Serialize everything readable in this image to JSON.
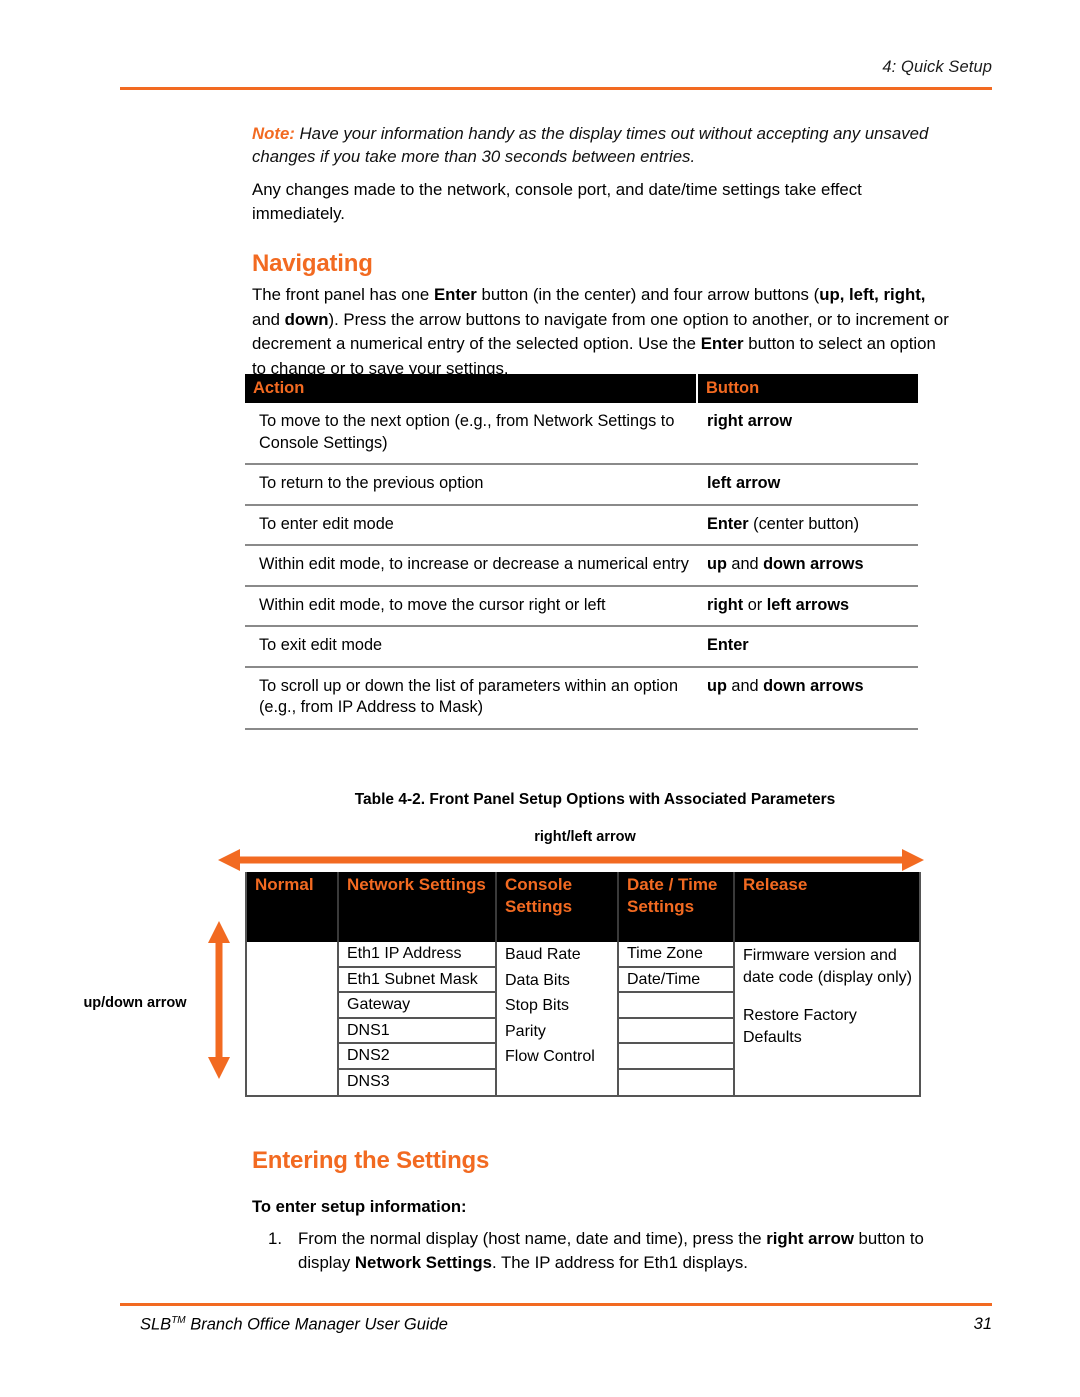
{
  "header": {
    "chapter": "4: Quick Setup",
    "rule_color": "#F26A21"
  },
  "note": {
    "label": "Note:",
    "text": " Have your information handy as the display times out without accepting any unsaved changes if you take more than 30 seconds between entries."
  },
  "paragraphs": {
    "immediate_effect": "Any changes made to the network, console port, and date/time settings take effect immediately."
  },
  "sections": {
    "navigating": "Navigating",
    "entering": "Entering the Settings"
  },
  "navigating_paragraph": {
    "p1": "The front panel has one ",
    "b1": "Enter",
    "p2": " button (in the center) and four arrow buttons (",
    "b2": "up, left, right,",
    "p3": " and ",
    "b3": "down",
    "p4": "). Press the arrow buttons to navigate from one option to another, or to increment or decrement a numerical entry of the selected option. Use the ",
    "b4": "Enter",
    "p5": " button to select an option to change or to save your settings."
  },
  "action_table": {
    "headers": [
      "Action",
      "Button"
    ],
    "rows": [
      {
        "action": "To move to the next option (e.g., from Network Settings to Console Settings)",
        "button_bold": "right arrow",
        "button_rest": ""
      },
      {
        "action": "To return to the previous option",
        "button_bold": "left arrow",
        "button_rest": ""
      },
      {
        "action": "To enter edit mode",
        "button_bold": "Enter",
        "button_rest": " (center button)"
      },
      {
        "action": "Within edit mode, to increase or decrease a numerical entry",
        "button_bold": "up",
        "button_mid": " and ",
        "button_bold2": "down arrows",
        "button_rest": ""
      },
      {
        "action": "Within edit mode, to move the cursor right or left",
        "button_bold": "right",
        "button_mid": " or ",
        "button_bold2": "left arrows",
        "button_rest": ""
      },
      {
        "action": "To exit edit mode",
        "button_bold": "Enter",
        "button_rest": ""
      },
      {
        "action": "To scroll up or down the list of parameters within an option (e.g., from IP Address to Mask)",
        "button_bold": "up",
        "button_mid": " and ",
        "button_bold2": "down arrows",
        "button_rest": ""
      }
    ]
  },
  "diagram": {
    "caption": "Table 4-2. Front Panel Setup Options with Associated Parameters",
    "horizontal_arrow_label": "right/left arrow",
    "vertical_arrow_label": "up/down arrow",
    "columns": [
      {
        "header": "Normal",
        "items": []
      },
      {
        "header": "Network Settings",
        "items": [
          "Eth1 IP Address",
          "Eth1 Subnet Mask",
          "Gateway",
          "DNS1",
          "DNS2",
          "DNS3"
        ]
      },
      {
        "header": "Console Settings",
        "items": [
          "Baud Rate",
          "Data Bits",
          "Stop Bits",
          "Parity",
          "Flow Control"
        ]
      },
      {
        "header": "Date / Time Settings",
        "items": [
          "Time Zone",
          "Date/Time"
        ]
      },
      {
        "header": "Release",
        "items": [
          "Firmware version and date code (display only)",
          "Restore Factory Defaults"
        ]
      }
    ]
  },
  "entering": {
    "lead_in": "To enter setup information:",
    "steps": [
      {
        "number": "1.",
        "p1": "From the normal display (host name, date and time), press the ",
        "b1": "right arrow",
        "p2": " button to display ",
        "b2": "Network Settings",
        "p3": ". The IP address for Eth1 displays."
      }
    ]
  },
  "footer": {
    "title_main": "SLB",
    "title_tm": "TM",
    "title_rest": " Branch Office Manager User Guide",
    "page_number": "31"
  }
}
